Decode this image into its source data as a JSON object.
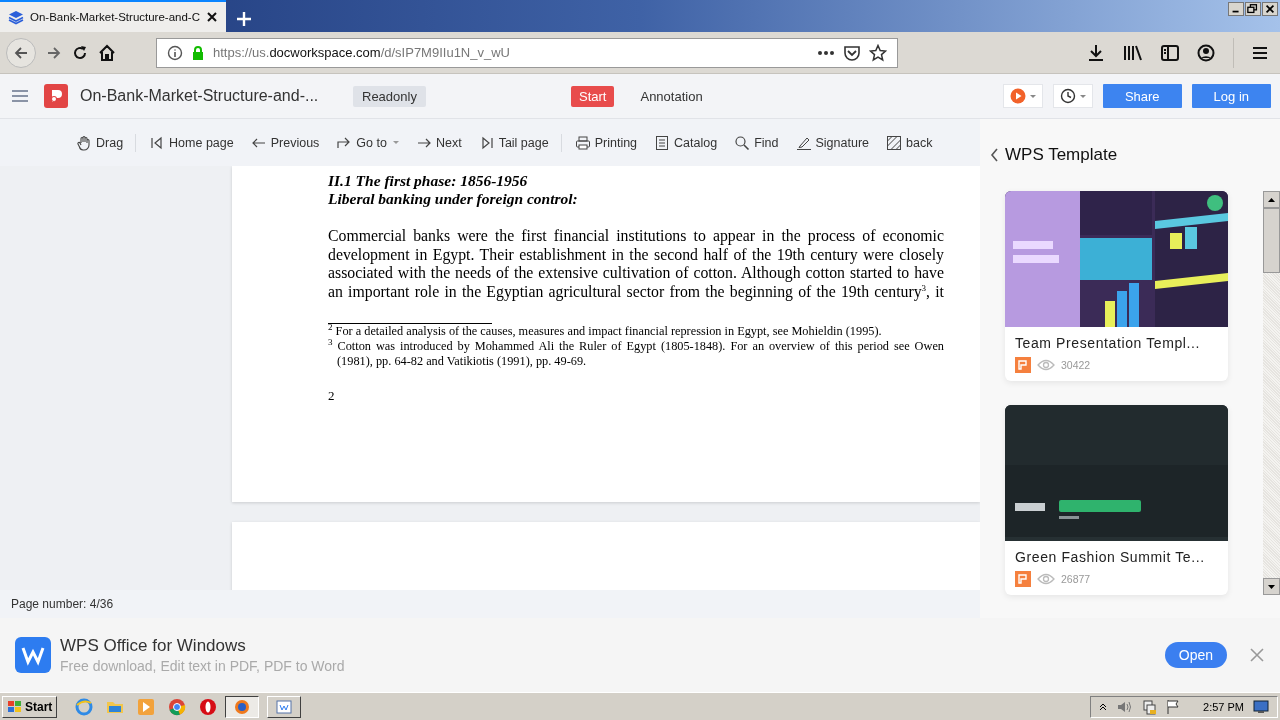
{
  "browser": {
    "tab_title": "On-Bank-Market-Structure-and-C",
    "url": {
      "scheme": "https://us.",
      "host": "docworkspace.com",
      "path": "/d/sIP7M9IIu1N_v_wU"
    }
  },
  "app": {
    "doc_title": "On-Bank-Market-Structure-and-...",
    "badge": "Readonly",
    "mode_tabs": [
      {
        "label": "Start",
        "selected": true
      },
      {
        "label": "Annotation",
        "selected": false
      }
    ],
    "buttons": [
      "Share",
      "Log in"
    ]
  },
  "toolbar": [
    {
      "label": "Drag",
      "has_menu": false
    },
    {
      "label": "Home page",
      "has_menu": false
    },
    {
      "label": "Previous",
      "has_menu": false
    },
    {
      "label": "Go to",
      "has_menu": true
    },
    {
      "label": "Next",
      "has_menu": false
    },
    {
      "label": "Tail page",
      "has_menu": false
    },
    {
      "label": "Printing",
      "has_menu": false
    },
    {
      "label": "Catalog",
      "has_menu": false
    },
    {
      "label": "Find",
      "has_menu": false
    },
    {
      "label": "Signature",
      "has_menu": false
    },
    {
      "label": "back",
      "has_menu": false
    }
  ],
  "document": {
    "headings": [
      "II.1 The first phase: 1856-1956",
      "Liberal banking under foreign control:"
    ],
    "paragraph": "Commercial banks were the first financial institutions to appear in the process of economic development in Egypt. Their establishment in the second half of the 19th century were closely associated with the needs of the extensive cultivation of cotton. Although cotton started to have an important role in the Egyptian agricultural sector from the beginning of the 19th century$^{3}$, it",
    "footnotes": [
      {
        "mark": "2",
        "text": "For a detailed analysis of the causes, measures and impact financial repression in Egypt, see Mohieldin (1995)."
      },
      {
        "mark": "3",
        "text": "Cotton was introduced by Mohammed Ali the Ruler of Egypt (1805-1848). For an overview of this period see Owen (1981), pp. 64-82 and Vatikiotis (1991), pp. 49-69."
      }
    ],
    "page_number": "2"
  },
  "status": "Page number: 4/36",
  "template_panel": {
    "title": "WPS Template",
    "cards": [
      {
        "title": "Team Presentation Templ...",
        "views": "30422"
      },
      {
        "title": "Green Fashion Summit Te...",
        "views": "26877"
      }
    ]
  },
  "banner": {
    "title": "WPS Office for Windows",
    "subtitle": "Free download, Edit text in PDF, PDF to Word",
    "button": "Open"
  },
  "taskbar": {
    "start": "Start",
    "tasks": [
      {
        "selected": true
      },
      {
        "selected": false
      }
    ],
    "clock": "2:57 PM"
  }
}
